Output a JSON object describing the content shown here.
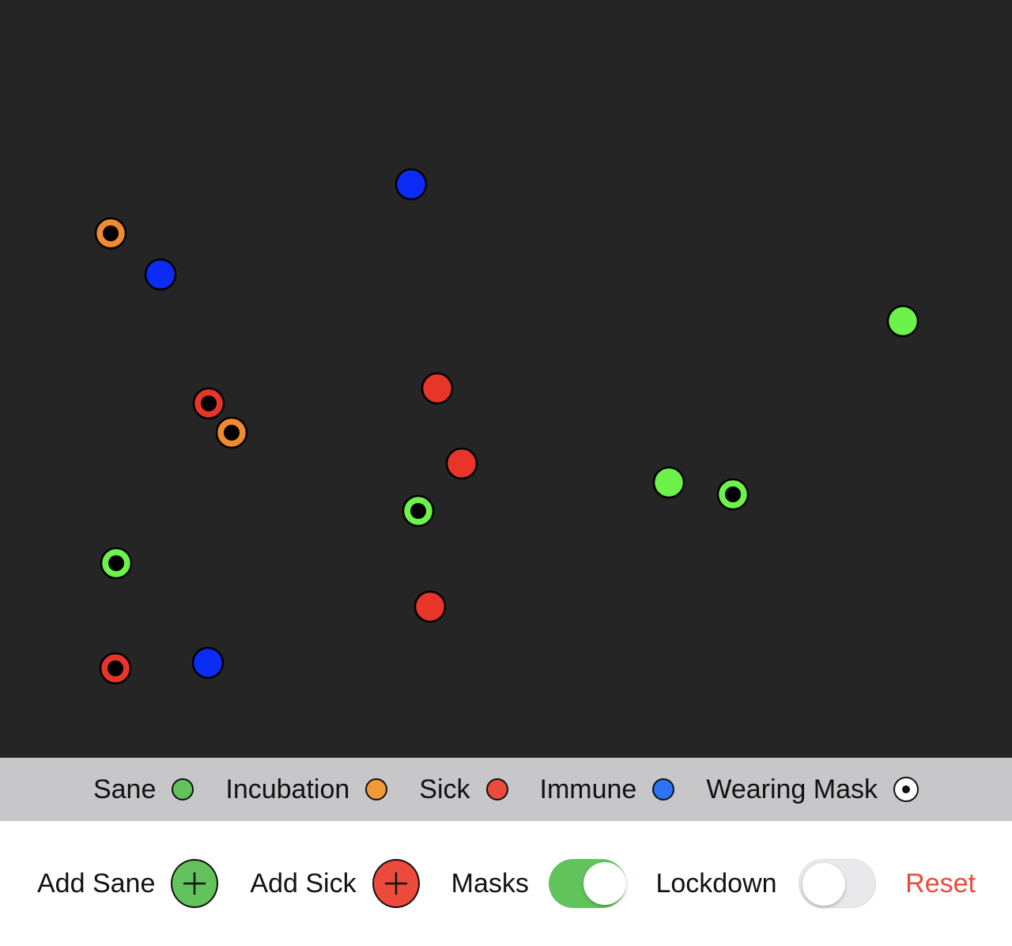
{
  "colors": {
    "sim_background": "#252525",
    "legend_background": "#c7c7c9",
    "sane": "#6cf24a",
    "incubation": "#f08a30",
    "sick": "#e8352a",
    "immune": "#0a2cf5",
    "legend_sane": "#62c35d",
    "legend_incubation": "#f09a3a",
    "legend_sick": "#ec4a3c",
    "legend_immune": "#2c74f5",
    "add_sane_button": "#62c35d",
    "add_sick_button": "#ec4a3c",
    "toggle_on": "#62c35d",
    "toggle_off": "#e9e9eb",
    "reset": "#ec4a3c"
  },
  "legend": {
    "sane_label": "Sane",
    "incubation_label": "Incubation",
    "sick_label": "Sick",
    "immune_label": "Immune",
    "mask_label": "Wearing Mask"
  },
  "controls": {
    "add_sane_label": "Add Sane",
    "add_sick_label": "Add Sick",
    "masks_label": "Masks",
    "masks_on": true,
    "lockdown_label": "Lockdown",
    "lockdown_on": false,
    "reset_label": "Reset"
  },
  "population": [
    {
      "state": "immune",
      "mask": false
    },
    {
      "state": "incubation",
      "mask": true
    },
    {
      "state": "immune",
      "mask": false
    },
    {
      "state": "sane",
      "mask": false
    },
    {
      "state": "sick",
      "mask": false
    },
    {
      "state": "sick",
      "mask": true
    },
    {
      "state": "incubation",
      "mask": true
    },
    {
      "state": "sick",
      "mask": false
    },
    {
      "state": "sane",
      "mask": true
    },
    {
      "state": "sane",
      "mask": false
    },
    {
      "state": "sane",
      "mask": true
    },
    {
      "state": "sane",
      "mask": true
    },
    {
      "state": "sick",
      "mask": false
    },
    {
      "state": "sick",
      "mask": true
    },
    {
      "state": "immune",
      "mask": false
    }
  ]
}
